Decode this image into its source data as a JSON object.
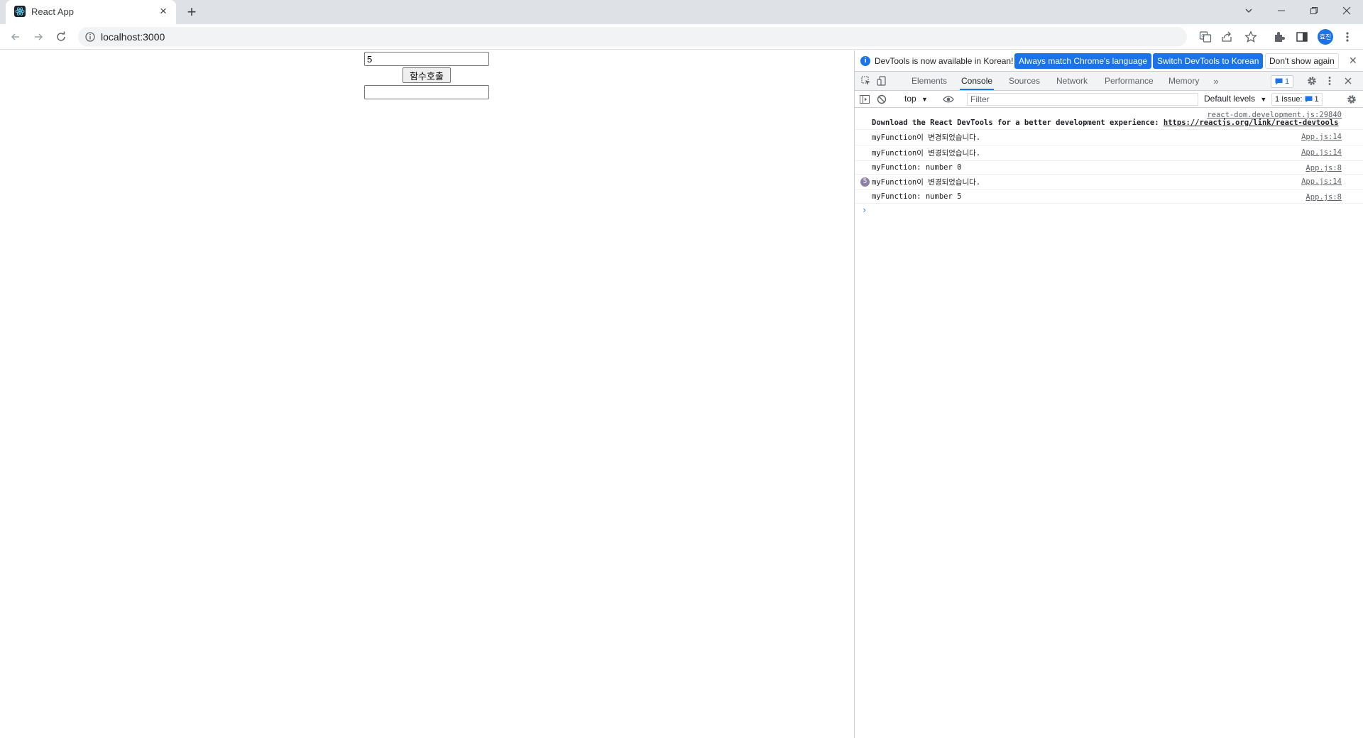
{
  "browser": {
    "tab": {
      "title": "React App"
    },
    "url": "localhost:3000",
    "avatar_text": "효진"
  },
  "app": {
    "input_value": "5",
    "button_label": "함수호출",
    "result_value": ""
  },
  "devtools": {
    "infobar": {
      "text": "DevTools is now available in Korean!",
      "btn_match": "Always match Chrome's language",
      "btn_switch": "Switch DevTools to Korean",
      "btn_dont_show": "Don't show again"
    },
    "tabs": [
      "Elements",
      "Console",
      "Sources",
      "Network",
      "Performance",
      "Memory"
    ],
    "active_tab": "Console",
    "messages_badge": "1",
    "console_toolbar": {
      "context": "top",
      "filter_placeholder": "Filter",
      "levels": "Default levels",
      "issues_label": "1 Issue:",
      "issues_count": "1"
    },
    "console_rows": [
      {
        "source": "react-dom.development.js:29840",
        "text": "Download the React DevTools for a better development experience: ",
        "link": "https://reactjs.org/link/react-devtools"
      },
      {
        "source": "App.js:14",
        "text": "myFunction이 변경되었습니다."
      },
      {
        "source": "App.js:14",
        "text": "myFunction이 변경되었습니다."
      },
      {
        "source": "App.js:8",
        "text": "myFunction: number 0"
      },
      {
        "source": "App.js:14",
        "text": "myFunction이 변경되었습니다.",
        "count": "5"
      },
      {
        "source": "App.js:8",
        "text": "myFunction: number 5"
      }
    ],
    "prompt": "›"
  },
  "colors": {
    "accent": "#1a73e8",
    "tabstrip": "#dee1e6"
  }
}
